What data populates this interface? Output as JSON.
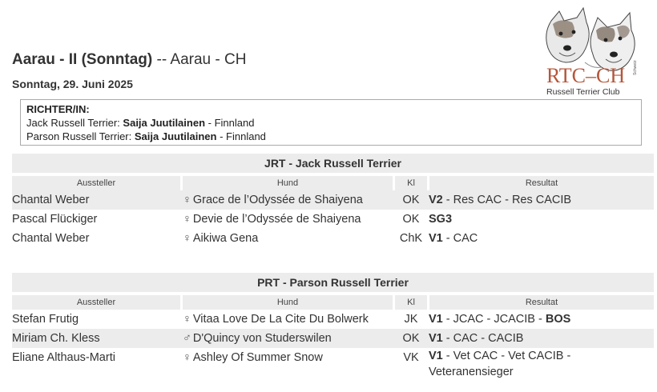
{
  "event": {
    "title_bold": "Aarau - II (Sonntag)",
    "title_rest": " -- Aarau - CH",
    "date": "Sonntag, 29. Juni 2025"
  },
  "logo": {
    "name": "RTC–CH",
    "subtitle": "Russell Terrier Club",
    "small": "Schweiz",
    "colors": {
      "brand": "#b5563a",
      "text": "#333333"
    }
  },
  "judges": {
    "heading": "RICHTER/IN:",
    "lines": [
      {
        "breed": "Jack Russell Terrier:",
        "judge": "Saija Juutilainen",
        "country": " - Finnland"
      },
      {
        "breed": "Parson Russell Terrier:",
        "judge": "Saija Juutilainen",
        "country": " - Finnland"
      }
    ]
  },
  "columns": {
    "exhibitor": "Aussteller",
    "dog": "Hund",
    "class": "Kl",
    "result": "Resultat"
  },
  "sections": [
    {
      "title": "JRT - Jack Russell Terrier",
      "rows": [
        {
          "exhibitor": "Chantal Weber",
          "sex": "♀",
          "dog": "Grace de l’Odyssée de Shaiyena",
          "class": "OK",
          "result_bold": "V2",
          "result_rest": " - Res CAC - Res CACIB"
        },
        {
          "exhibitor": "Pascal Flückiger",
          "sex": "♀",
          "dog": "Devie de l’Odyssée de Shaiyena",
          "class": "OK",
          "result_bold": "SG3",
          "result_rest": ""
        },
        {
          "exhibitor": "Chantal Weber",
          "sex": "♀",
          "dog": "Aikiwa Gena",
          "class": "ChK",
          "result_bold": "V1",
          "result_rest": " - CAC"
        }
      ]
    },
    {
      "title": "PRT - Parson Russell Terrier",
      "rows": [
        {
          "exhibitor": "Stefan Frutig",
          "sex": "♀",
          "dog": "Vitaa Love De La Cite Du Bolwerk",
          "class": "JK",
          "result_bold": "V1",
          "result_rest": " - JCAC - JCACIB - ",
          "result_bold2": "BOS"
        },
        {
          "exhibitor": "Miriam Ch. Kless",
          "sex": "♂",
          "dog": "D'Quincy von Studerswilen",
          "class": "OK",
          "result_bold": "V1",
          "result_rest": " - CAC - CACIB"
        },
        {
          "exhibitor": "Eliane Althaus-Marti",
          "sex": "♀",
          "dog": "Ashley Of Summer Snow",
          "class": "VK",
          "result_bold": "V1",
          "result_rest": " - Vet CAC - Vet CACIB - Veteranensieger"
        }
      ]
    }
  ]
}
